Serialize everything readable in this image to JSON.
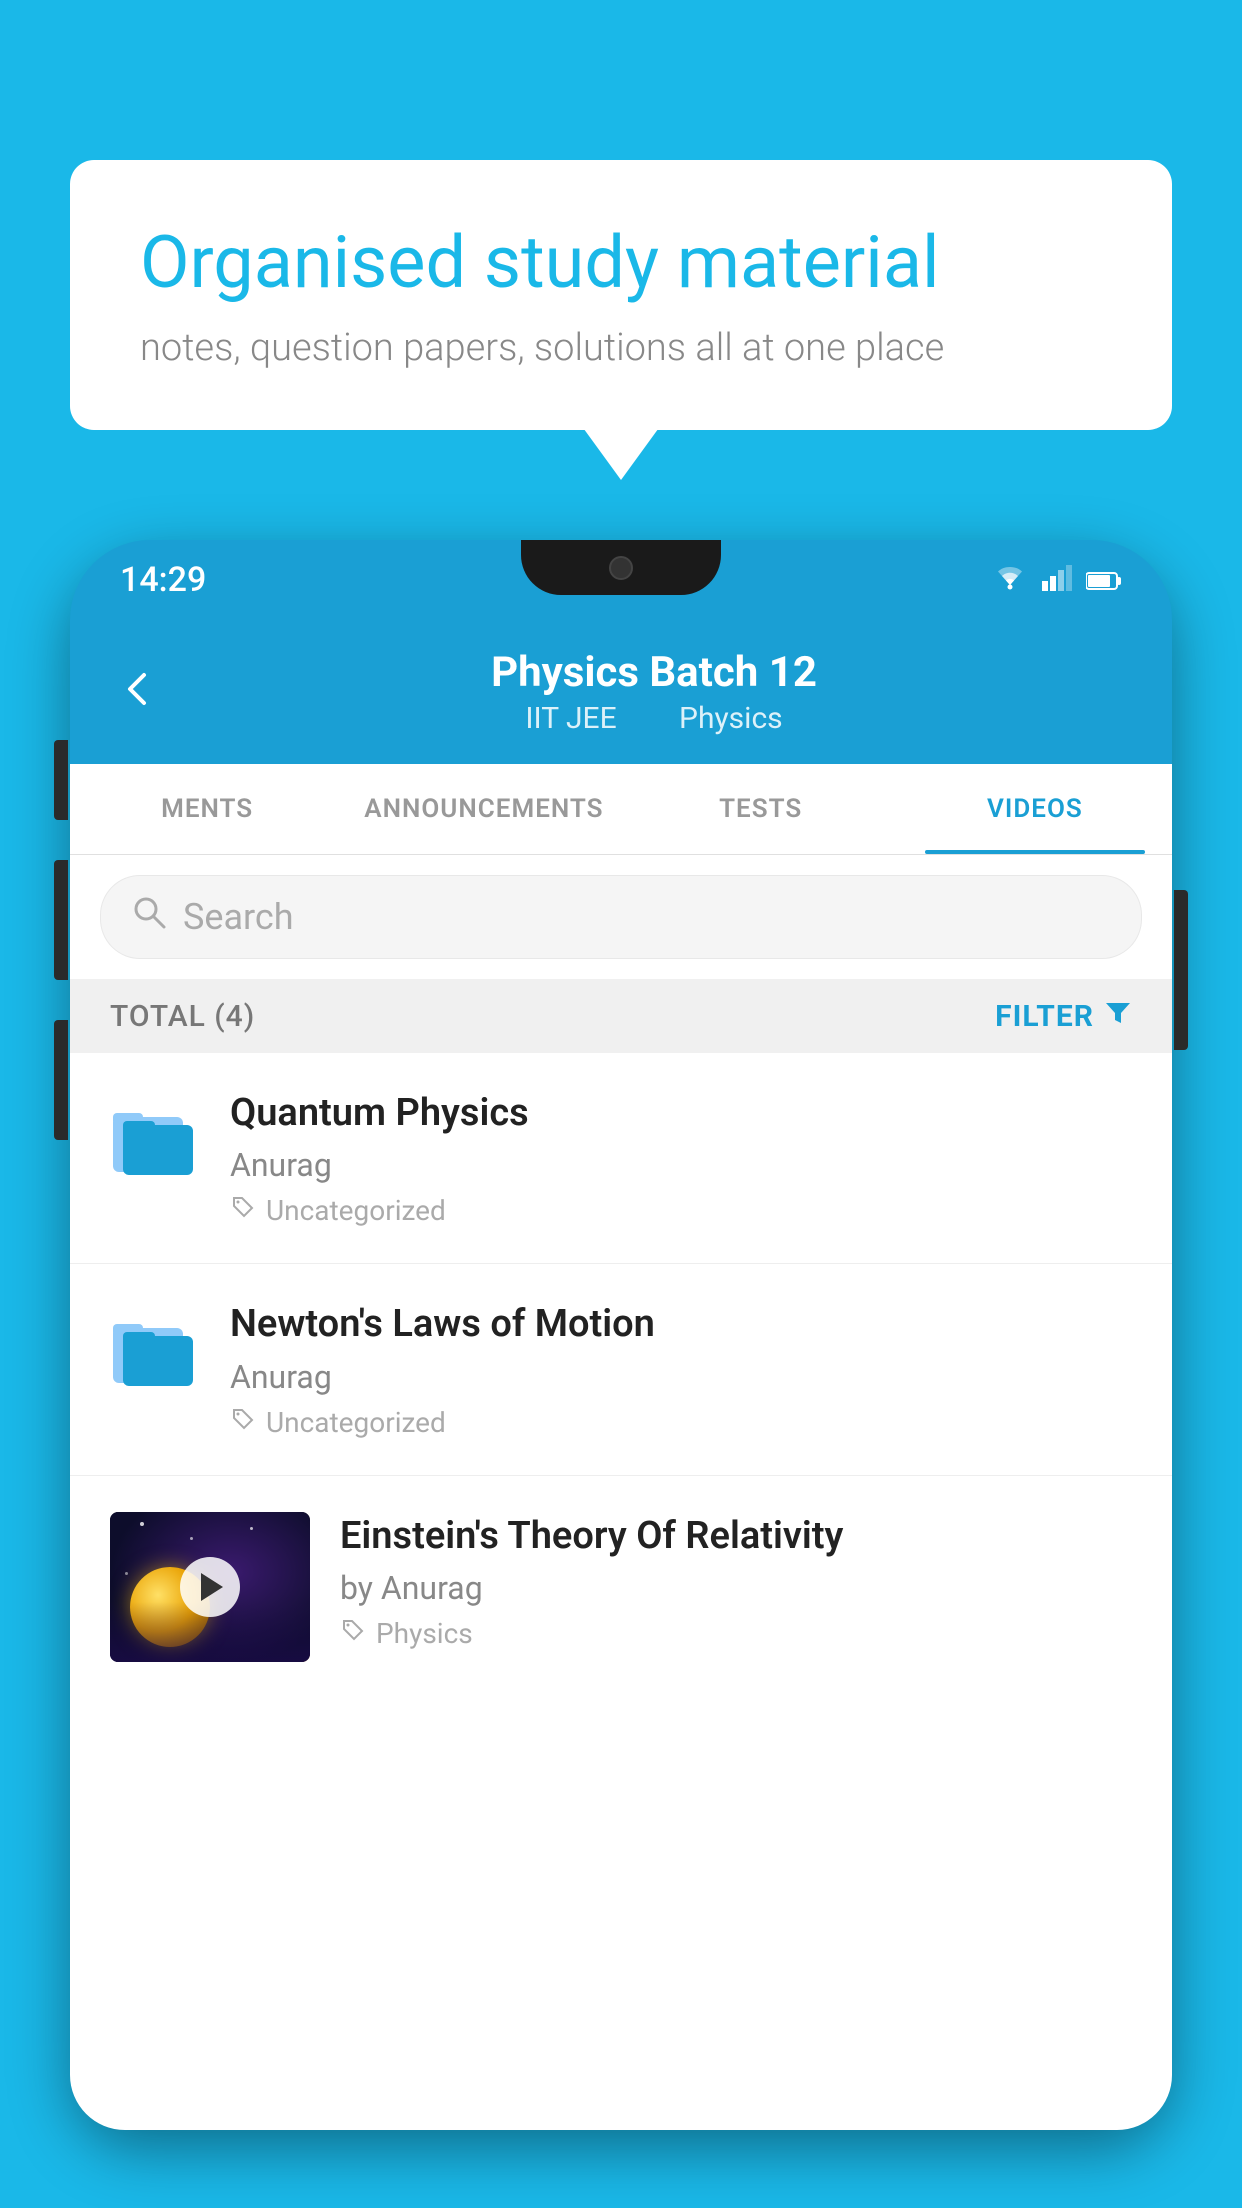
{
  "background": {
    "color": "#1ab8e8"
  },
  "speech_bubble": {
    "title": "Organised study material",
    "subtitle": "notes, question papers, solutions all at one place"
  },
  "phone": {
    "status_bar": {
      "time": "14:29"
    },
    "app_header": {
      "title": "Physics Batch 12",
      "subtitle_part1": "IIT JEE",
      "subtitle_part2": "Physics"
    },
    "tabs": [
      {
        "label": "MENTS",
        "active": false
      },
      {
        "label": "ANNOUNCEMENTS",
        "active": false
      },
      {
        "label": "TESTS",
        "active": false
      },
      {
        "label": "VIDEOS",
        "active": true
      }
    ],
    "search": {
      "placeholder": "Search"
    },
    "filter_bar": {
      "total_label": "TOTAL (4)",
      "filter_label": "FILTER"
    },
    "videos": [
      {
        "title": "Quantum Physics",
        "author": "Anurag",
        "tag": "Uncategorized",
        "has_thumb": false
      },
      {
        "title": "Newton's Laws of Motion",
        "author": "Anurag",
        "tag": "Uncategorized",
        "has_thumb": false
      },
      {
        "title": "Einstein's Theory Of Relativity",
        "author": "by Anurag",
        "tag": "Physics",
        "has_thumb": true
      }
    ]
  }
}
